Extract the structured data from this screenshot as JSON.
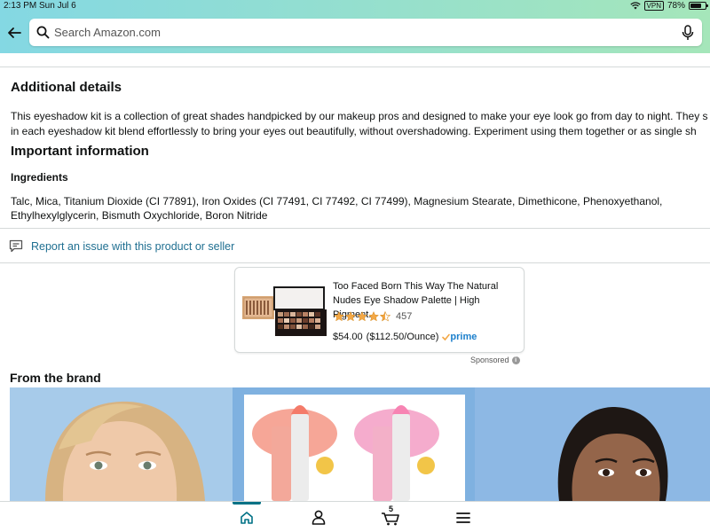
{
  "status_bar": {
    "time": "2:13 PM",
    "date": "Sun Jul 6",
    "vpn": "VPN",
    "battery": "78%",
    "battery_level": 0.78
  },
  "header": {
    "gradient_colors": [
      "#84d8e3",
      "#a5e6ba"
    ],
    "search_placeholder": "Search Amazon.com",
    "icons": [
      "back-arrow-icon",
      "search-icon",
      "microphone-icon"
    ]
  },
  "additional_details": {
    "heading": "Additional details",
    "line1": "This eyeshadow kit is a collection of great shades handpicked by our makeup pros and designed to make your eye look go from day to night. They s",
    "line2": "in each eyeshadow kit blend effortlessly to bring your eyes out beautifully, without overshadowing. Experiment using them together or as single sh"
  },
  "important_information": {
    "heading": "Important information",
    "ingredients_label": "Ingredients",
    "ingredients_line1": "Talc, Mica, Titanium Dioxide (CI 77891), Iron Oxides (CI 77491, CI 77492, CI 77499), Magnesium Stearate, Dimethicone, Phenoxyethanol,",
    "ingredients_line2": "Ethylhexylglycerin, Bismuth Oxychloride, Boron Nitride"
  },
  "report": {
    "label": "Report an issue with this product or seller",
    "link_color": "#1f6f91"
  },
  "sponsored_ad": {
    "title": "Too Faced Born This Way The Natural Nudes Eye Shadow Palette | High Pigment...",
    "rating": 4.5,
    "rating_count": "457",
    "price": "$54.00",
    "unit_price": "($112.50/Ounce)",
    "prime_label": "prime",
    "sponsored_label": "Sponsored",
    "star_color": "#f3a847"
  },
  "brand": {
    "heading": "From the brand"
  },
  "bottom_nav": {
    "items": [
      "home-icon",
      "account-icon",
      "cart-icon",
      "menu-icon"
    ],
    "cart_count": "5",
    "active_color": "#007185"
  }
}
